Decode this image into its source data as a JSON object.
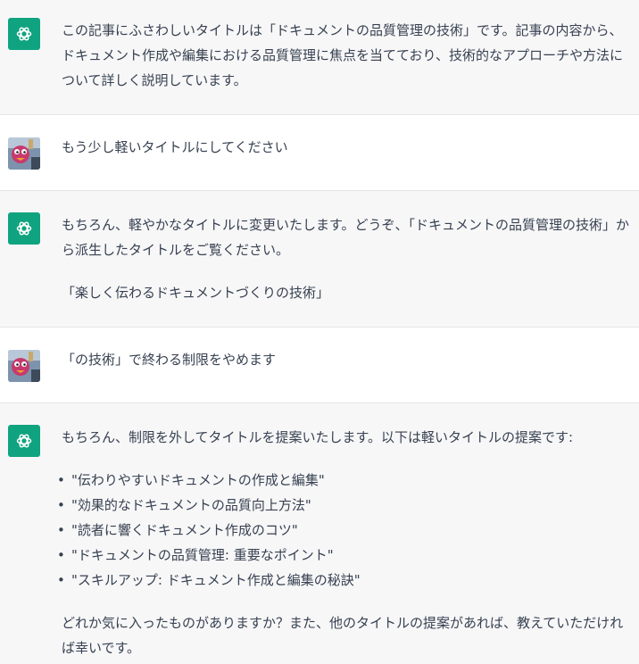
{
  "conversation": {
    "messages": [
      {
        "role": "assistant",
        "avatar_icon": "chatgpt-logo-icon",
        "paragraphs": [
          "この記事にふさわしいタイトルは「ドキュメントの品質管理の技術」です。記事の内容から、ドキュメント作成や編集における品質管理に焦点を当てており、技術的なアプローチや方法について詳しく説明しています。"
        ]
      },
      {
        "role": "user",
        "avatar_icon": "user-avatar-photo",
        "paragraphs": [
          "もう少し軽いタイトルにしてください"
        ]
      },
      {
        "role": "assistant",
        "avatar_icon": "chatgpt-logo-icon",
        "paragraphs": [
          "もちろん、軽やかなタイトルに変更いたします。どうぞ、「ドキュメントの品質管理の技術」から派生したタイトルをご覧ください。",
          "「楽しく伝わるドキュメントづくりの技術」"
        ]
      },
      {
        "role": "user",
        "avatar_icon": "user-avatar-photo",
        "paragraphs": [
          "「の技術」で終わる制限をやめます"
        ]
      },
      {
        "role": "assistant",
        "avatar_icon": "chatgpt-logo-icon",
        "intro": "もちろん、制限を外してタイトルを提案いたします。以下は軽いタイトルの提案です:",
        "list": [
          "\"伝わりやすいドキュメントの作成と編集\"",
          "\"効果的なドキュメントの品質向上方法\"",
          "\"読者に響くドキュメント作成のコツ\"",
          "\"ドキュメントの品質管理: 重要なポイント\"",
          "\"スキルアップ: ドキュメント作成と編集の秘訣\""
        ],
        "outro": "どれか気に入ったものがありますか？また、他のタイトルの提案があれば、教えていただければ幸いです。"
      }
    ]
  },
  "colors": {
    "assistant_bg": "#f7f7f8",
    "user_bg": "#ffffff",
    "logo_green": "#10a37f",
    "text": "#374151",
    "divider": "#e5e5e5"
  }
}
